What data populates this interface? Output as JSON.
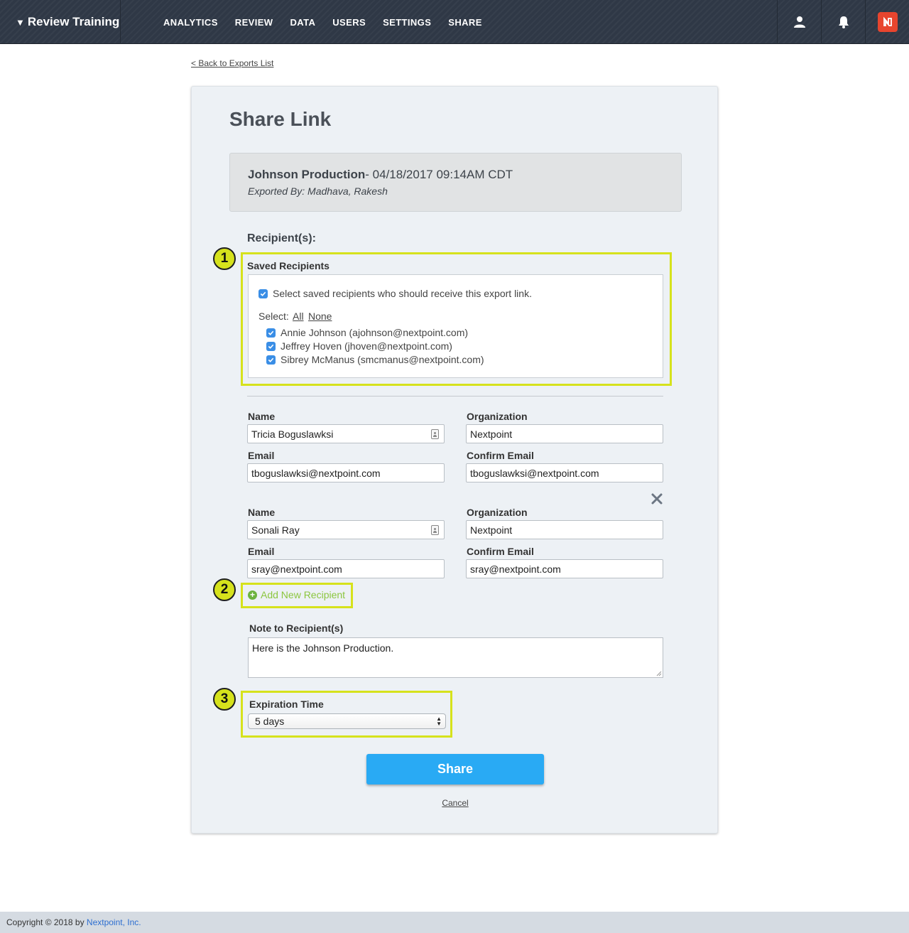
{
  "header": {
    "brand": "Review Training",
    "nav": [
      "ANALYTICS",
      "REVIEW",
      "DATA",
      "USERS",
      "SETTINGS",
      "SHARE"
    ],
    "icons": [
      "user-icon",
      "bell-icon",
      "nextpoint-logo-icon"
    ],
    "logo_color": "#e8452e"
  },
  "back_link": "< Back to Exports List",
  "page": {
    "title": "Share Link",
    "export": {
      "name": "Johnson Production",
      "date": "- 04/18/2017 09:14AM CDT",
      "exported_by": "Exported By: Madhava, Rakesh"
    },
    "recipients_heading": "Recipient(s):",
    "saved": {
      "title": "Saved Recipients",
      "toggle_label": "Select saved recipients who should receive this export link.",
      "select_label": "Select:",
      "select_all": "All",
      "select_none": "None",
      "recipients": [
        {
          "label": "Annie Johnson (ajohnson@nextpoint.com)",
          "checked": true
        },
        {
          "label": "Jeffrey Hoven (jhoven@nextpoint.com)",
          "checked": true
        },
        {
          "label": "Sibrey McManus (smcmanus@nextpoint.com)",
          "checked": true
        }
      ]
    },
    "form_labels": {
      "name": "Name",
      "organization": "Organization",
      "email": "Email",
      "confirm_email": "Confirm Email"
    },
    "new_recipients": [
      {
        "name": "Tricia Boguslawksi",
        "organization": "Nextpoint",
        "email": "tboguslawksi@nextpoint.com",
        "confirm_email": "tboguslawksi@nextpoint.com"
      },
      {
        "name": "Sonali Ray",
        "organization": "Nextpoint",
        "email": "sray@nextpoint.com",
        "confirm_email": "sray@nextpoint.com"
      }
    ],
    "add_recipient": "Add New Recipient",
    "note": {
      "label": "Note to Recipient(s)",
      "value": "Here is the Johnson Production."
    },
    "expiration": {
      "label": "Expiration Time",
      "value": "5 days"
    },
    "share_button": "Share",
    "cancel": "Cancel"
  },
  "callouts": [
    "1",
    "2",
    "3"
  ],
  "highlight_color": "#d6e21c",
  "accent_color": "#29aaf4",
  "footer": {
    "text": "Copyright © 2018 by ",
    "link": "Nextpoint, Inc."
  }
}
